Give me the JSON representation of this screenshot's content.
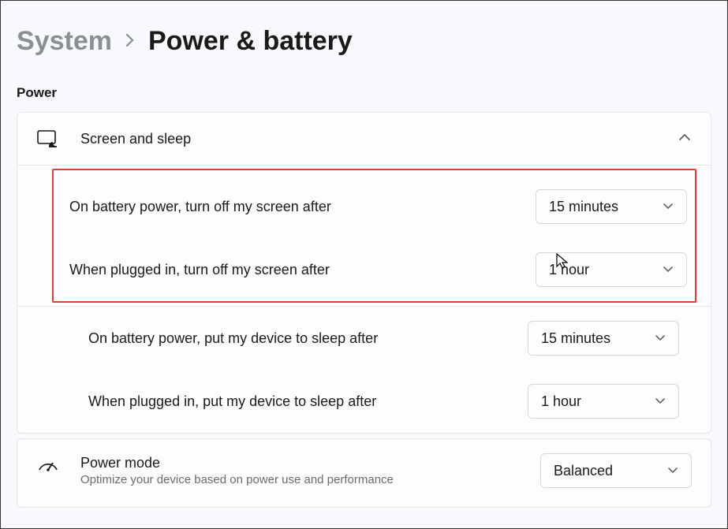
{
  "breadcrumb": {
    "parent": "System",
    "current": "Power & battery"
  },
  "section_label": "Power",
  "screen_sleep": {
    "title": "Screen and sleep",
    "rows": {
      "battery_screen": {
        "label": "On battery power, turn off my screen after",
        "value": "15 minutes"
      },
      "plugged_screen": {
        "label": "When plugged in, turn off my screen after",
        "value": "1 hour"
      },
      "battery_sleep": {
        "label": "On battery power, put my device to sleep after",
        "value": "15 minutes"
      },
      "plugged_sleep": {
        "label": "When plugged in, put my device to sleep after",
        "value": "1 hour"
      }
    }
  },
  "power_mode": {
    "title": "Power mode",
    "subtitle": "Optimize your device based on power use and performance",
    "value": "Balanced"
  }
}
